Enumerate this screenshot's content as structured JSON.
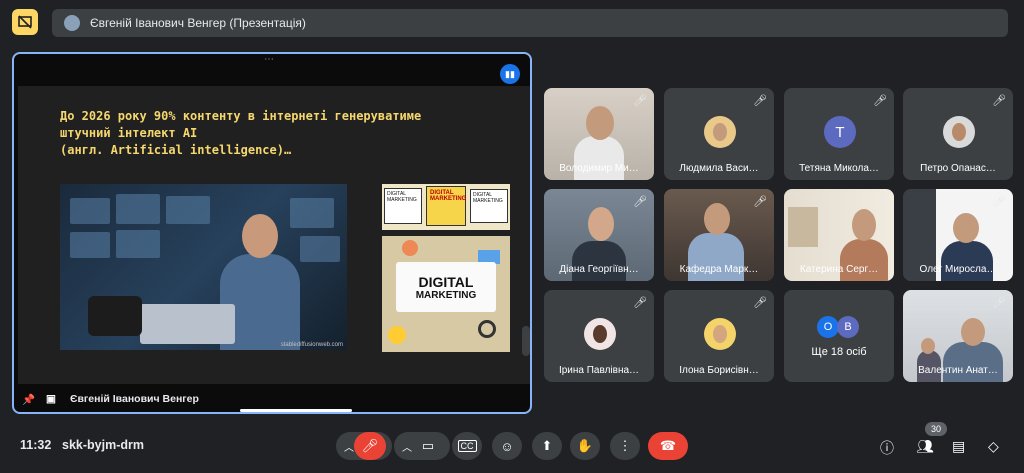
{
  "window": {
    "presenter_title": "Євгеній Іванович Венгер (Презентація)"
  },
  "stage": {
    "slide_text": "До 2026 року 90% контенту в інтернеті генеруватиме\nштучний інтелект AI\n(англ. Artificial intelligence)…",
    "photo_watermark": "stablediffusionweb.com",
    "dm_top_labels": [
      "DIGITAL MARKETING",
      "DIGITAL MARKETING",
      "DIGITAL MARKETING"
    ],
    "dm_card_line1": "DIGITAL",
    "dm_card_line2": "MARKETING",
    "presenter_name": "Євгеній Іванович Венгер"
  },
  "participants": [
    {
      "name": "Володимир Ми…",
      "type": "video"
    },
    {
      "name": "Людмила Васи…",
      "type": "photo"
    },
    {
      "name": "Тетяна Микола…",
      "type": "letter",
      "letter": "T"
    },
    {
      "name": "Петро Опанас…",
      "type": "photo"
    },
    {
      "name": "Діана Георгіївн…",
      "type": "video"
    },
    {
      "name": "Кафедра Марк…",
      "type": "video"
    },
    {
      "name": "Катерина Серг…",
      "type": "video"
    },
    {
      "name": "Олег Миросла…",
      "type": "video"
    },
    {
      "name": "Ірина Павлівна…",
      "type": "photo"
    },
    {
      "name": "Ілона Борисівн…",
      "type": "photo"
    },
    {
      "name": "Ще 18 осіб",
      "type": "more",
      "avatars": [
        "O",
        "B"
      ]
    },
    {
      "name": "Валентин Анат…",
      "type": "video"
    }
  ],
  "colors": {
    "accent": "#8ab4f8",
    "hangup": "#ea4335",
    "mic_off": "#ea4335",
    "slide_text": "#f5d76e",
    "present_icon": "#fdd663"
  },
  "bottombar": {
    "time": "11:32",
    "meeting_code": "skk-byjm-drm",
    "people_count": "30",
    "cc_label": "CC"
  }
}
